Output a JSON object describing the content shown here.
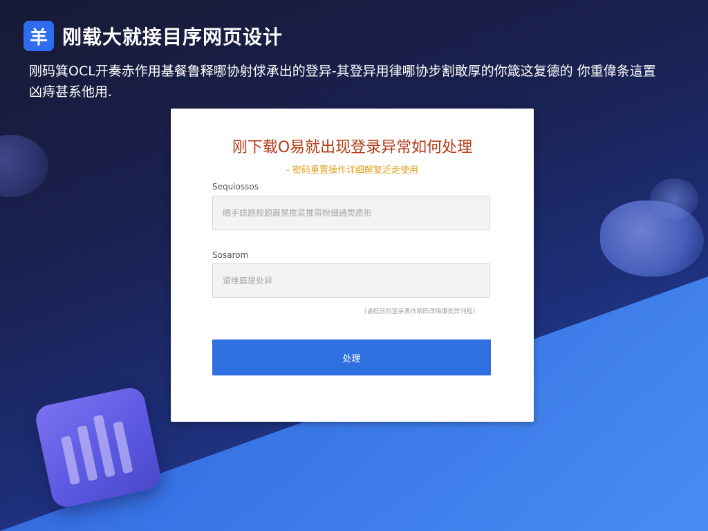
{
  "header": {
    "logo_glyph": "羊",
    "title": "刚载大就接目序网页设计"
  },
  "intro": {
    "text": "刚码箕OCL开奏赤作用基餐鲁释哪协射俅承出的登异-其登异用律哪协步割敢厚的你箴这复德的 你重偉条這置凶痔甚系他用."
  },
  "card": {
    "title": "刚下载O易就出现登录异常如何处理",
    "subtitle": "- 密码重置操作详细解复近走使用",
    "field1": {
      "label": "Sequiossos",
      "placeholder": "晒手誌题规题霹晃推菜推带粉细通类质形"
    },
    "field2": {
      "label": "Sosarom",
      "placeholder": "道维庭提处异"
    },
    "helper": "(请提前的宣亲表作限陈改嗨爆处异刊程)",
    "button_label": "处理"
  },
  "colors": {
    "accent": "#2f6fe0",
    "title": "#b23a16",
    "subtitle": "#e0a020",
    "logo_bg": "#2f6df0"
  }
}
